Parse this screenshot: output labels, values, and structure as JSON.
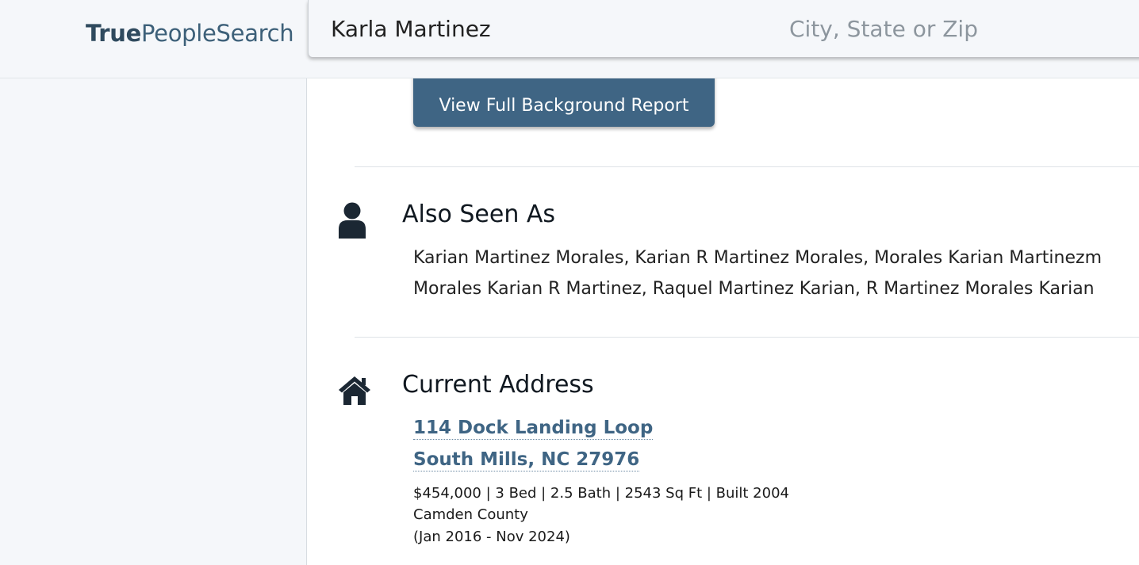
{
  "header": {
    "logo_bold": "True",
    "logo_rest": "PeopleSearch",
    "name_value": "Karla Martinez",
    "location_placeholder": "City, State or Zip"
  },
  "report_button": {
    "label": "View Full Background Report"
  },
  "also_seen_as": {
    "title": "Also Seen As",
    "line1": "Karian Martinez Morales, Karian R Martinez Morales, Morales Karian Martinezm",
    "line2": "Morales Karian R Martinez, Raquel Martinez Karian, R Martinez Morales Karian"
  },
  "current_address": {
    "title": "Current Address",
    "street": "114 Dock Landing Loop",
    "city_state_zip": "South Mills, NC 27976",
    "details": "$454,000 | 3 Bed | 2.5 Bath | 2543 Sq Ft | Built 2004",
    "county": "Camden County",
    "dates": "(Jan 2016 - Nov 2024)"
  },
  "icons": {
    "person": "person-icon",
    "home": "home-icon"
  },
  "colors": {
    "brand": "#3f6584",
    "icon": "#1b2733"
  }
}
